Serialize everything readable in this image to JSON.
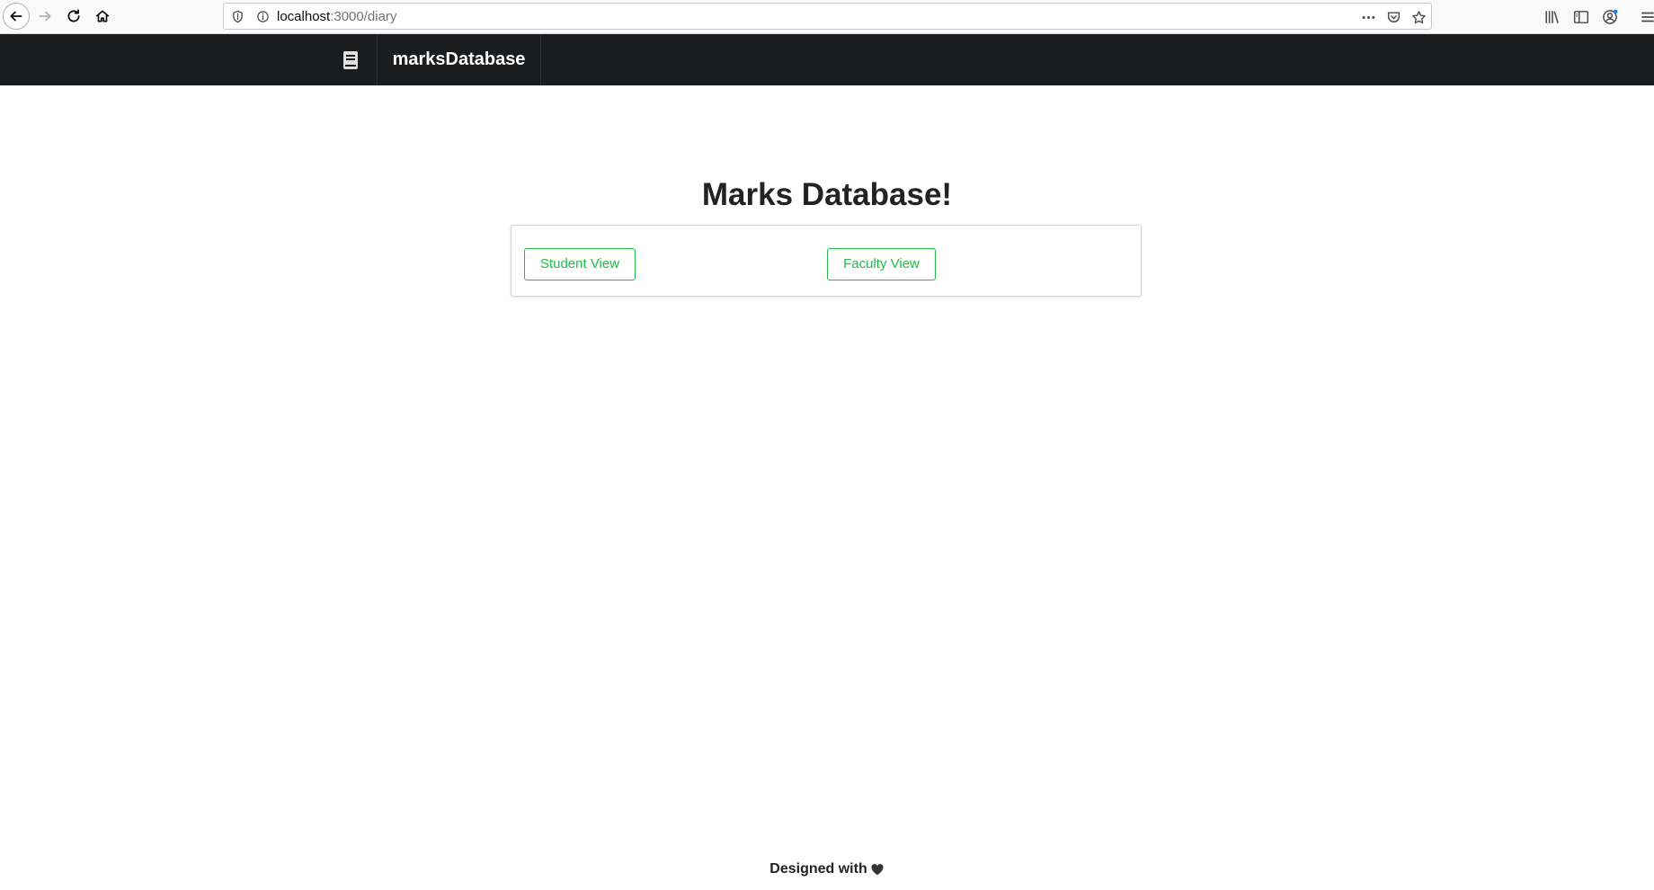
{
  "browser": {
    "url_host": "localhost",
    "url_path": ":3000/diary"
  },
  "navbar": {
    "icon": "book-icon",
    "brand": "marksDatabase"
  },
  "main": {
    "title": "Marks Database!",
    "buttons": {
      "student": "Student View",
      "faculty": "Faculty View"
    },
    "accent_color": "#21ba45"
  },
  "footer": {
    "text": "Designed with",
    "icon": "heart-icon"
  }
}
